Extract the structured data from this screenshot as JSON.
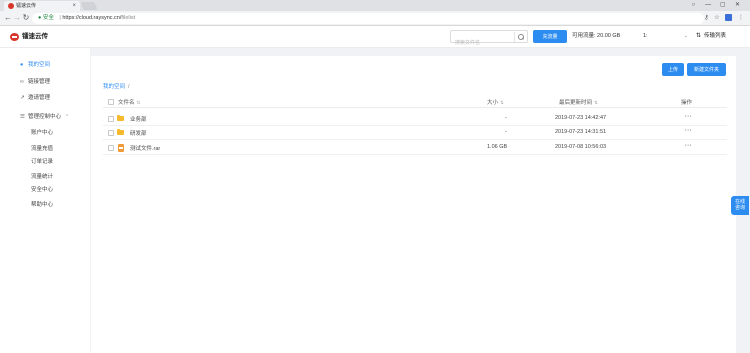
{
  "browser": {
    "tab_title": "镭速云传",
    "tab_close": "×",
    "window_buttons": [
      "○",
      "—",
      "▢",
      "✕"
    ],
    "nav": {
      "back": "←",
      "forward": "→",
      "reload": "↻"
    },
    "address": {
      "lock": "🔒",
      "secure_label": "安全",
      "sep": " | ",
      "url_base": "https://cloud.raysync.cn/",
      "url_path": "filelist"
    },
    "toolbar_icons": [
      "⚷",
      "☆",
      "⋮"
    ]
  },
  "header": {
    "logo_text": "镭速云传",
    "search_placeholder": "搜索文件名",
    "recharge_label": "充流量",
    "available_traffic": "可用流量: 20.00 GB",
    "user_select_value": "1:",
    "transfer_list_label": "传输列表",
    "transfer_icon": "⇅"
  },
  "sidebar": {
    "items": [
      {
        "icon": "👤",
        "label": "我的空间",
        "active": true
      },
      {
        "icon": "🔗",
        "label": "链接管理",
        "active": false
      },
      {
        "icon": "↗",
        "label": "邀请管理",
        "active": false
      },
      {
        "icon": "☰",
        "label": "管理控制中心",
        "active": false
      }
    ],
    "submenu": [
      "账户中心",
      "流量充值",
      "订单记录",
      "流量统计",
      "安全中心",
      "帮助中心"
    ],
    "chevron": "⌄"
  },
  "main": {
    "upload_label": "上传",
    "new_folder_label": "新建文件夹",
    "breadcrumb": {
      "root": "我的空间",
      "sep": "/"
    },
    "columns": {
      "name": "文件名",
      "size": "大小",
      "modified": "最后更新时间",
      "actions": "操作"
    },
    "sort_icon": "⇅",
    "rows": [
      {
        "type": "folder",
        "name": "业务部",
        "size": "-",
        "modified": "2019-07-23 14:42:47",
        "actions": "···"
      },
      {
        "type": "folder",
        "name": "研发部",
        "size": "-",
        "modified": "2019-07-23 14:31:51",
        "actions": "···"
      },
      {
        "type": "file",
        "name": "测试文件.rar",
        "size": "1.06 GB",
        "modified": "2019-07-08 10:56:03",
        "actions": "···"
      }
    ]
  },
  "online_chat": {
    "line1": "在线",
    "line2": "咨询"
  },
  "colors": {
    "primary": "#2d8cf0",
    "folder": "#f7b92e",
    "file": "#f19a38",
    "brand": "#d9362b"
  }
}
